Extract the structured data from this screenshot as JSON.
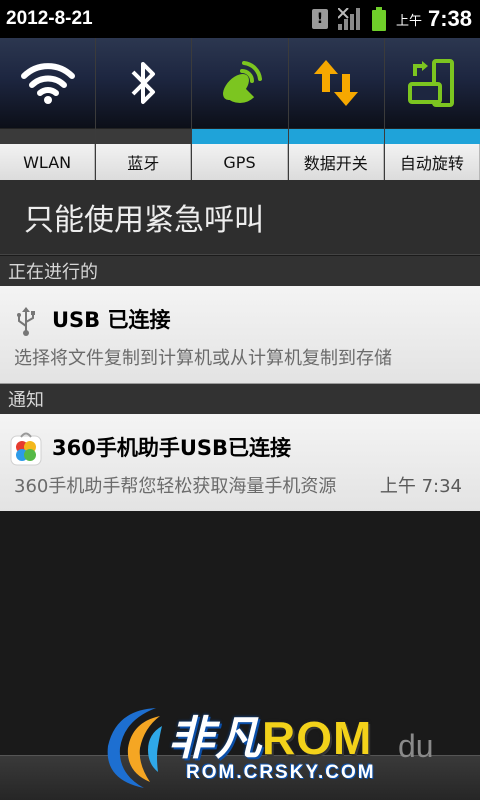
{
  "statusbar": {
    "date": "2012-8-21",
    "ampm": "上午",
    "time": "7:38",
    "alert_icon": "!",
    "icons": [
      "alert-icon",
      "signal-icon",
      "battery-icon"
    ]
  },
  "toggles": [
    {
      "label": "WLAN",
      "icon": "wifi-icon",
      "on": false
    },
    {
      "label": "蓝牙",
      "icon": "bluetooth-icon",
      "on": false
    },
    {
      "label": "GPS",
      "icon": "gps-icon",
      "on": true
    },
    {
      "label": "数据开关",
      "icon": "data-arrows-icon",
      "on": true
    },
    {
      "label": "自动旋转",
      "icon": "rotate-icon",
      "on": true
    }
  ],
  "emergency": {
    "text": "只能使用紧急呼叫"
  },
  "sections": {
    "ongoing": "正在进行的",
    "notifications": "通知"
  },
  "ongoing_items": [
    {
      "icon": "usb-icon",
      "title": "USB 已连接",
      "text": "选择将文件复制到计算机或从计算机复制到存储"
    }
  ],
  "notification_items": [
    {
      "icon": "360-assistant-icon",
      "title": "360手机助手USB已连接",
      "text": "360手机助手帮您轻松获取海量手机资源",
      "time": "上午 7:34"
    }
  ],
  "watermark": {
    "brand": "非凡",
    "rom": "ROM",
    "url": "ROM.CRSKY.COM",
    "du": "du"
  },
  "colors": {
    "toggle_on": "#1fa3d9",
    "gps_green": "#7cc520",
    "data_orange": "#f6a800",
    "rotate_green": "#7cc520"
  }
}
